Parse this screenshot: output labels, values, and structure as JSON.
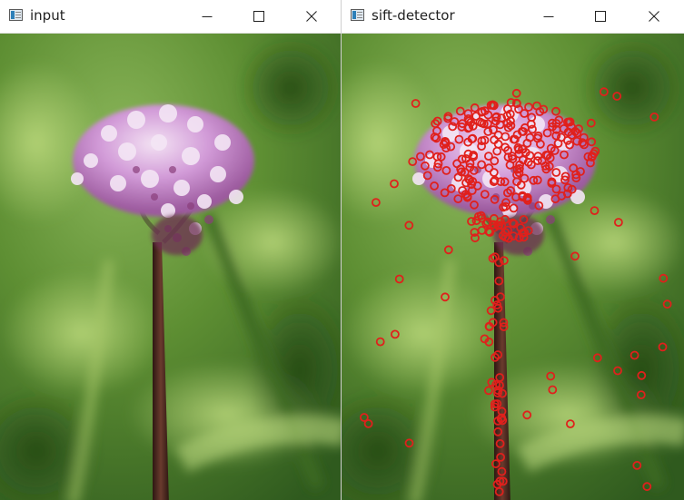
{
  "windows": {
    "left": {
      "title": "input",
      "icon": "app-window-icon"
    },
    "right": {
      "title": "sift-detector",
      "icon": "app-window-icon"
    }
  },
  "window_controls": [
    "minimize-icon",
    "maximize-icon",
    "close-icon"
  ],
  "images": {
    "input": {
      "content": "flower-photo"
    },
    "sift": {
      "content": "flower-photo-with-keypoints",
      "keypoint_color": "#e0201c"
    }
  },
  "colors": {
    "titlebar": "#ffffff",
    "keypoint": "#e0201c",
    "petal": "#c98fd3",
    "stem": "#4a2a22",
    "background_green": "#6a9a3c"
  }
}
